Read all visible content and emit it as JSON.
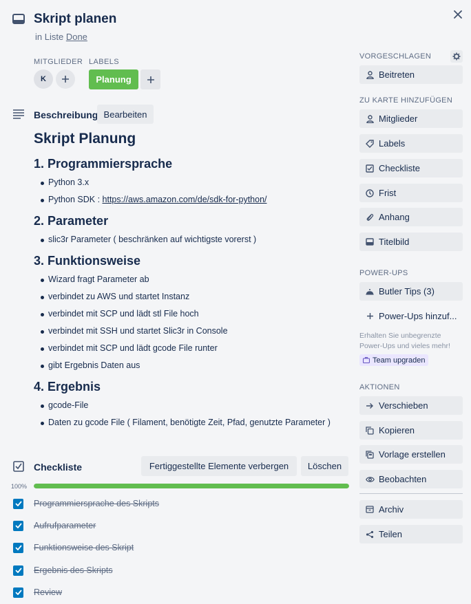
{
  "card": {
    "title": "Skript planen",
    "in_list_prefix": "in Liste",
    "list_name": "Done"
  },
  "members": {
    "label": "MITGLIEDER",
    "avatar_initial": "K"
  },
  "labels": {
    "label": "LABELS",
    "items": [
      {
        "name": "Planung",
        "color": "#61bd4f"
      }
    ]
  },
  "description": {
    "header": "Beschreibung",
    "edit_button": "Bearbeiten",
    "h1": "Skript Planung",
    "sections": [
      {
        "heading": "1. Programmiersprache",
        "items": [
          "Python 3.x"
        ],
        "sdk_prefix": "Python SDK : ",
        "sdk_link": "https://aws.amazon.com/de/sdk-for-python/"
      },
      {
        "heading": "2. Parameter",
        "items": [
          "slic3r Parameter ( beschränken auf wichtigste vorerst )"
        ]
      },
      {
        "heading": "3. Funktionsweise",
        "items": [
          "Wizard fragt Parameter ab",
          "verbindet zu AWS und startet Instanz",
          "verbindet mit SCP und lädt stl File hoch",
          "verbindet mit SSH und startet Slic3r in Console",
          "verbindet mit SCP und lädt gcode File runter",
          "gibt Ergebnis Daten aus"
        ]
      },
      {
        "heading": "4. Ergebnis",
        "items": [
          "gcode-File",
          "Daten zu gcode File ( Filament, benötigte Zeit, Pfad, genutzte Parameter )"
        ]
      }
    ]
  },
  "checklist": {
    "header": "Checkliste",
    "hide_button": "Fertiggestellte Elemente verbergen",
    "delete_button": "Löschen",
    "progress_label": "100%",
    "progress": 1.0,
    "items": [
      {
        "text": "Programmiersprache des Skripts",
        "checked": true
      },
      {
        "text": "Aufrufparameter",
        "checked": true
      },
      {
        "text": "Funktionsweise des Skript",
        "checked": true
      },
      {
        "text": "Ergebnis des Skripts",
        "checked": true
      },
      {
        "text": "Review",
        "checked": true
      }
    ]
  },
  "sidebar": {
    "suggested_label": "VORGESCHLAGEN",
    "join_button": "Beitreten",
    "add_label": "ZU KARTE HINZUFÜGEN",
    "add_items": [
      {
        "label": "Mitglieder",
        "icon": "person-icon"
      },
      {
        "label": "Labels",
        "icon": "tag-icon"
      },
      {
        "label": "Checkliste",
        "icon": "checklist-icon"
      },
      {
        "label": "Frist",
        "icon": "clock-icon"
      },
      {
        "label": "Anhang",
        "icon": "paperclip-icon"
      },
      {
        "label": "Titelbild",
        "icon": "cover-icon"
      }
    ],
    "powerups_label": "POWER-UPS",
    "butler_button": "Butler Tips (3)",
    "add_powerups": "Power-Ups hinzuf...",
    "upsell": "Erhalten Sie unbegrenzte Power-Ups und vieles mehr!",
    "team_upgrade": "Team upgraden",
    "actions_label": "AKTIONEN",
    "actions": [
      {
        "label": "Verschieben",
        "icon": "arrow-right-icon"
      },
      {
        "label": "Kopieren",
        "icon": "copy-icon"
      },
      {
        "label": "Vorlage erstellen",
        "icon": "template-icon"
      },
      {
        "label": "Beobachten",
        "icon": "eye-icon"
      }
    ],
    "archive_button": "Archiv",
    "share_button": "Teilen"
  }
}
